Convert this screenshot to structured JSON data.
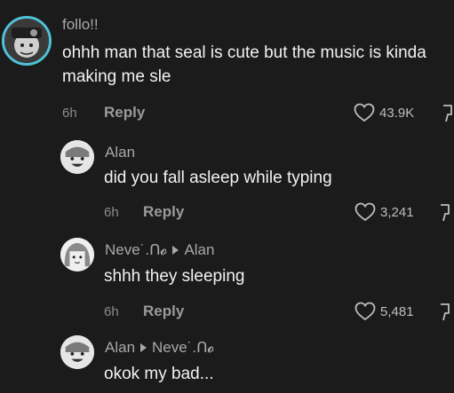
{
  "comments": [
    {
      "username": "follo!!",
      "text": "ohhh man that seal is cute but the music is kinda making me sle",
      "time": "6h",
      "reply_label": "Reply",
      "likes": "43.9K",
      "avatar_icon": "avatar-icon",
      "like_icon": "heart-icon",
      "dislike_icon": "dislike-icon"
    },
    {
      "username": "Alan",
      "text": "did you fall asleep while typing",
      "time": "6h",
      "reply_label": "Reply",
      "likes": "3,241",
      "avatar_icon": "avatar-icon",
      "like_icon": "heart-icon",
      "dislike_icon": "dislike-icon"
    },
    {
      "username": "Neve˙.ᑎ𝓸",
      "reply_to": "Alan",
      "text": "shhh they sleeping",
      "time": "6h",
      "reply_label": "Reply",
      "likes": "5,481",
      "avatar_icon": "avatar-icon",
      "like_icon": "heart-icon",
      "dislike_icon": "dislike-icon"
    },
    {
      "username": "Alan",
      "reply_to": "Neve˙.ᑎ𝓸",
      "text": "okok my bad...",
      "avatar_icon": "avatar-icon"
    }
  ],
  "colors": {
    "background": "#1b1b1b",
    "text": "#f2f2f2",
    "muted": "#a8a8a8",
    "avatar_ring": "#4fc3d9"
  }
}
